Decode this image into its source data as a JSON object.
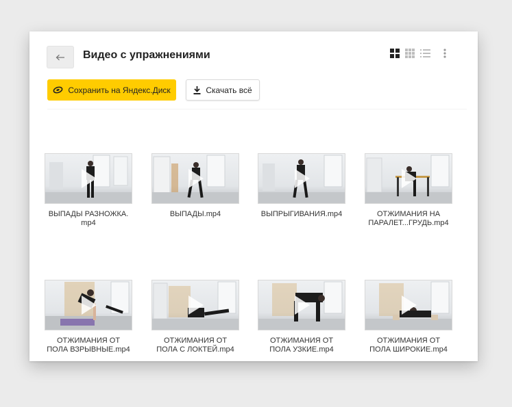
{
  "header": {
    "title": "Видео с упражнениями",
    "back_icon": "arrow-left-icon"
  },
  "view_icons": [
    "large-grid-icon",
    "small-grid-icon",
    "list-view-icon"
  ],
  "more_icon": "kebab-menu-icon",
  "actions": {
    "save_label": "Сохранить на Яндекс.Диск",
    "download_label": "Скачать всё"
  },
  "files": [
    {
      "name_line1": "ВЫПАДЫ РАЗНОЖКА.",
      "name_line2": "mp4"
    },
    {
      "name_line1": "ВЫПАДЫ.mp4",
      "name_line2": ""
    },
    {
      "name_line1": "ВЫПРЫГИВАНИЯ.mp4",
      "name_line2": ""
    },
    {
      "name_line1": "ОТЖИМАНИЯ НА",
      "name_line2": "ПАРАЛЕТ...ГРУДЬ.mp4"
    },
    {
      "name_line1": "ОТЖИМАНИЯ ОТ",
      "name_line2": "ПОЛА ВЗРЫВНЫЕ.mp4"
    },
    {
      "name_line1": "ОТЖИМАНИЯ ОТ",
      "name_line2": "ПОЛА С ЛОКТЕЙ.mp4"
    },
    {
      "name_line1": "ОТЖИМАНИЯ ОТ",
      "name_line2": "ПОЛА УЗКИЕ.mp4"
    },
    {
      "name_line1": "ОТЖИМАНИЯ ОТ",
      "name_line2": "ПОЛА ШИРОКИЕ.mp4"
    }
  ]
}
